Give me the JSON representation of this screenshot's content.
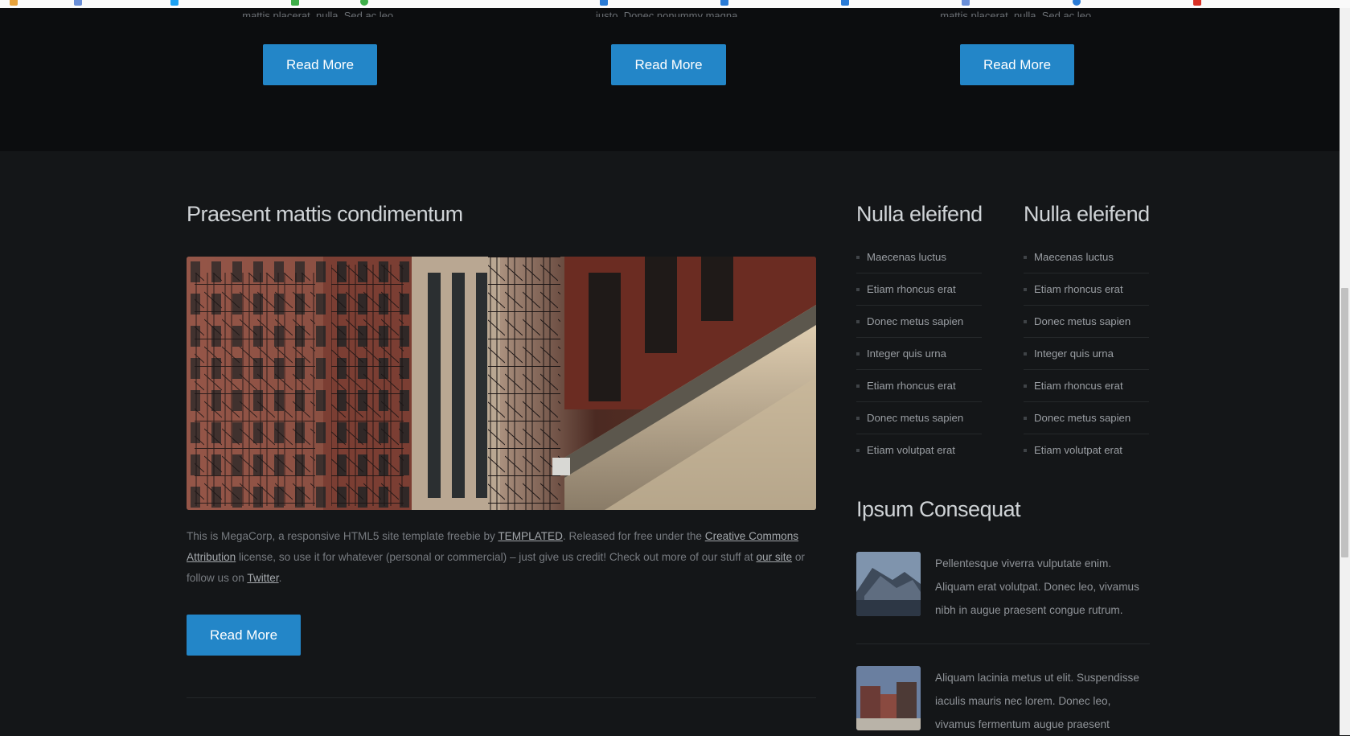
{
  "bookmarks_bar": {
    "item_colors": [
      "#e8a23a",
      "#6a8fd8",
      "#1da1f2",
      "#3fae49",
      "#2a7bd6",
      "#d93025"
    ]
  },
  "features": {
    "items": [
      {
        "text": "mattis placerat, nulla. Sed ac leo.",
        "button": "Read More"
      },
      {
        "text": "justo. Donec nonummy magna.",
        "button": "Read More"
      },
      {
        "text": "mattis placerat, nulla. Sed ac leo.",
        "button": "Read More"
      }
    ]
  },
  "article": {
    "title": "Praesent mattis condimentum",
    "photo_alt_icon": "building-fire-escape-photo",
    "para_1": "This is MegaCorp, a responsive HTML5 site template freebie by ",
    "link_templated": "TEMPLATED",
    "para_2": ". Released for free under the ",
    "link_cc": "Creative Commons Attribution",
    "para_3": " license, so use it for whatever (personal or commercial) – just give us credit! Check out more of our stuff at ",
    "link_site": "our site",
    "para_4": " or follow us on ",
    "link_twitter": "Twitter",
    "para_5": ".",
    "button": "Read More"
  },
  "sidebar": {
    "col1": {
      "title": "Nulla eleifend",
      "items": [
        "Maecenas luctus",
        "Etiam rhoncus erat",
        "Donec metus sapien",
        "Integer quis urna",
        "Etiam rhoncus erat",
        "Donec metus sapien",
        "Etiam volutpat erat"
      ]
    },
    "col2": {
      "title": "Nulla eleifend",
      "items": [
        "Maecenas luctus",
        "Etiam rhoncus erat",
        "Donec metus sapien",
        "Integer quis urna",
        "Etiam rhoncus erat",
        "Donec metus sapien",
        "Etiam volutpat erat"
      ]
    },
    "ipsum": {
      "title": "Ipsum Consequat",
      "posts": [
        {
          "text": "Pellentesque viverra vulputate enim. Aliquam erat volutpat. Donec leo, vivamus nibh in augue praesent congue rutrum."
        },
        {
          "text": "Aliquam lacinia metus ut elit. Suspendisse iaculis mauris nec lorem. Donec leo, vivamus fermentum augue praesent"
        }
      ]
    }
  },
  "colors": {
    "accent": "#2386c8",
    "background": "#141618",
    "top_band": "#0c0d0f"
  }
}
